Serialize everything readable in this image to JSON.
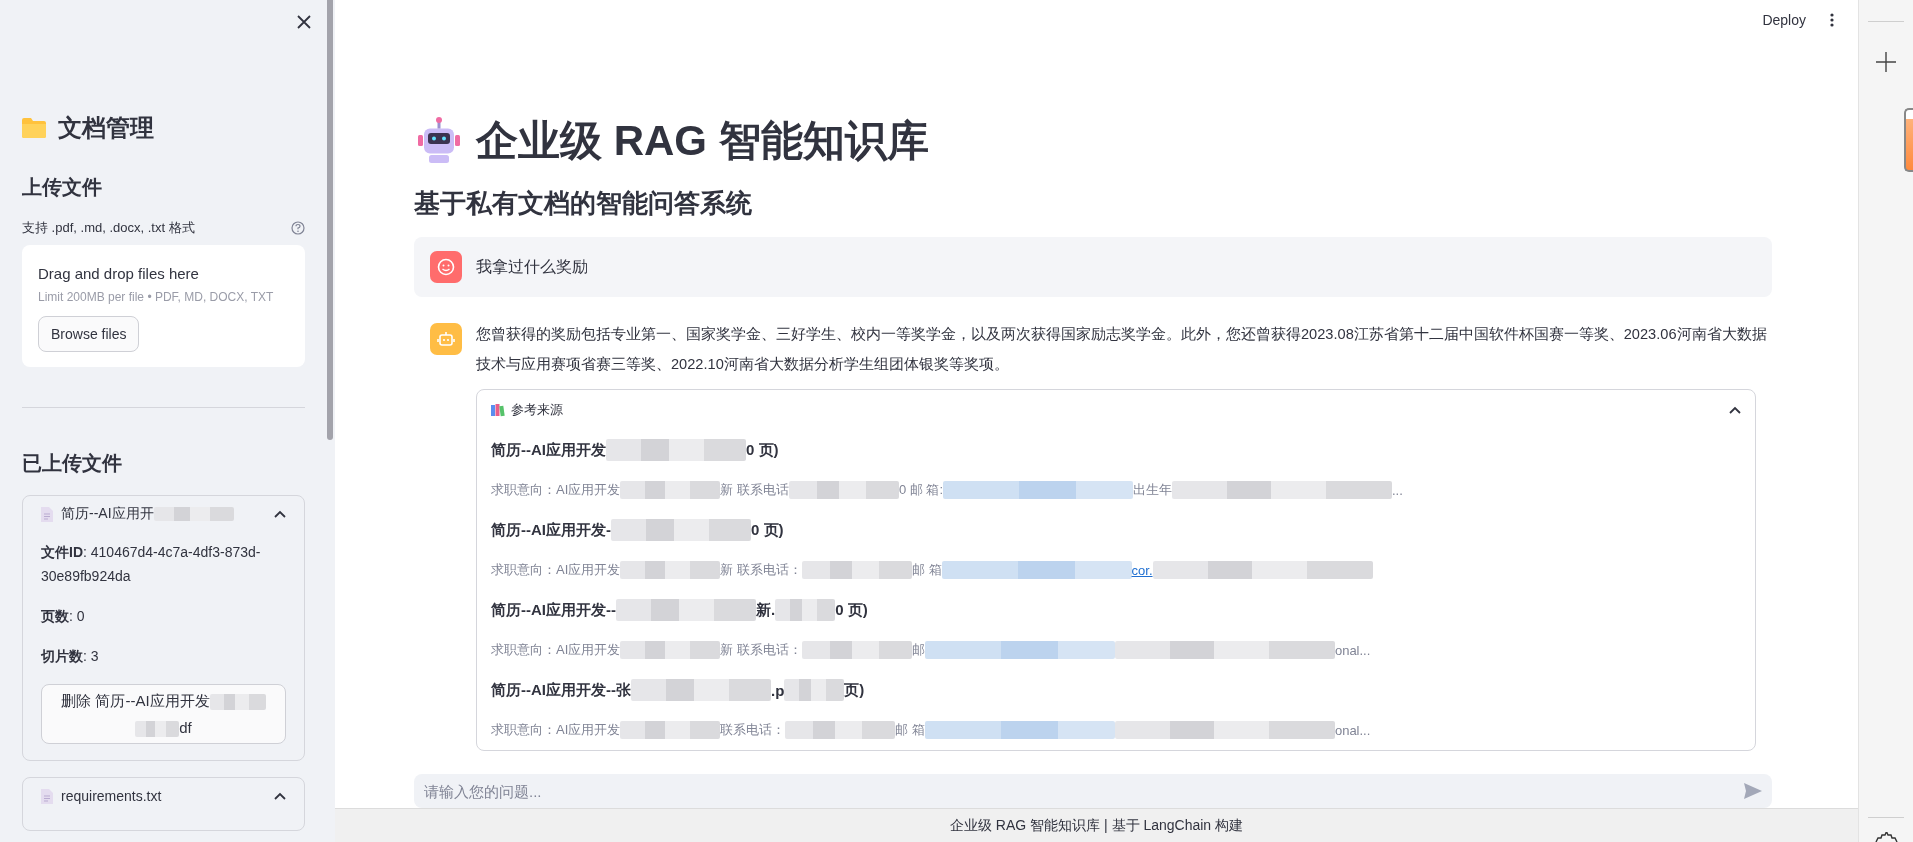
{
  "sidebar": {
    "title": "文档管理",
    "upload_heading": "上传文件",
    "upload_label": "支持 .pdf, .md, .docx, .txt 格式",
    "dropzone": {
      "title": "Drag and drop files here",
      "hint": "Limit 200MB per file • PDF, MD, DOCX, TXT",
      "button": "Browse files"
    },
    "uploaded_heading": "已上传文件",
    "files": [
      {
        "title": [
          {
            "kind": "text",
            "text": "简历--AI应用开"
          },
          {
            "kind": "blur"
          }
        ],
        "expanded": true,
        "details": [
          "**文件ID**: 410467d4-4c7a-4df3-873d-30e89fb924da",
          "**页数**: 0",
          "**切片数**: 3"
        ],
        "delete_button": [
          {
            "kind": "text",
            "text": "删除 简历--AI应用开发"
          },
          {
            "kind": "blur"
          },
          {
            "kind": "blur"
          },
          {
            "kind": "text",
            "text": "df"
          }
        ]
      },
      {
        "title": [
          {
            "kind": "text",
            "text": "requirements.txt"
          }
        ],
        "expanded": true
      }
    ]
  },
  "toolbar": {
    "deploy": "Deploy"
  },
  "main": {
    "title": "企业级 RAG 智能知识库",
    "subtitle": "基于私有文档的智能问答系统",
    "messages": [
      {
        "kind": "user",
        "text": "我拿过什么奖励"
      },
      {
        "kind": "assistant",
        "text": "您曾获得的奖励包括专业第一、国家奖学金、三好学生、校内一等奖学金，以及两次获得国家励志奖学金。此外，您还曾获得2023.08江苏省第十二届中国软件杯国赛一等奖、2023.06河南省大数据技术与应用赛项省赛三等奖、2022.10河南省大数据分析学生组团体银奖等奖项。",
        "sources": {
          "title": "参考来源",
          "expanded": true,
          "items": [
            {
              "title": [
                {
                  "kind": "text",
                  "text": "简历--AI应用开发"
                },
                {
                  "kind": "blur"
                },
                {
                  "kind": "text",
                  "text": "0 页)"
                }
              ],
              "snippet": [
                {
                  "kind": "text",
                  "text": "求职意向：AI应用开发"
                },
                {
                  "kind": "blur"
                },
                {
                  "kind": "text",
                  "text": "新 联系电话"
                },
                {
                  "kind": "blur"
                },
                {
                  "kind": "text",
                  "text": "0 邮 箱:"
                },
                {
                  "kind": "blur-link"
                },
                {
                  "kind": "text",
                  "text": "出生年"
                },
                {
                  "kind": "blur"
                },
                {
                  "kind": "text",
                  "text": "..."
                }
              ]
            },
            {
              "title": [
                {
                  "kind": "text",
                  "text": "简历--AI应用开发-"
                },
                {
                  "kind": "blur"
                },
                {
                  "kind": "text",
                  "text": "0 页)"
                }
              ],
              "snippet": [
                {
                  "kind": "text",
                  "text": "求职意向：AI应用开发"
                },
                {
                  "kind": "blur"
                },
                {
                  "kind": "text",
                  "text": "新 联系电话："
                },
                {
                  "kind": "blur"
                },
                {
                  "kind": "text",
                  "text": "邮 箱"
                },
                {
                  "kind": "blur-link"
                },
                {
                  "kind": "link",
                  "text": "cor."
                },
                {
                  "kind": "blur"
                }
              ]
            },
            {
              "title": [
                {
                  "kind": "text",
                  "text": "简历--AI应用开发--"
                },
                {
                  "kind": "blur"
                },
                {
                  "kind": "text",
                  "text": "新."
                },
                {
                  "kind": "blur"
                },
                {
                  "kind": "text",
                  "text": "0 页)"
                }
              ],
              "snippet": [
                {
                  "kind": "text",
                  "text": "求职意向：AI应用开发"
                },
                {
                  "kind": "blur"
                },
                {
                  "kind": "text",
                  "text": "新 联系电话："
                },
                {
                  "kind": "blur"
                },
                {
                  "kind": "text",
                  "text": "邮"
                },
                {
                  "kind": "blur-link"
                },
                {
                  "kind": "blur"
                },
                {
                  "kind": "text",
                  "text": "onal..."
                }
              ]
            },
            {
              "title": [
                {
                  "kind": "text",
                  "text": "简历--AI应用开发--张"
                },
                {
                  "kind": "blur"
                },
                {
                  "kind": "text",
                  "text": ".p"
                },
                {
                  "kind": "blur"
                },
                {
                  "kind": "text",
                  "text": "页)"
                }
              ],
              "snippet": [
                {
                  "kind": "text",
                  "text": "求职意向：AI应用开发"
                },
                {
                  "kind": "blur"
                },
                {
                  "kind": "text",
                  "text": "联系电话："
                },
                {
                  "kind": "blur"
                },
                {
                  "kind": "text",
                  "text": "邮 箱"
                },
                {
                  "kind": "blur-link"
                },
                {
                  "kind": "blur"
                },
                {
                  "kind": "text",
                  "text": "onal..."
                }
              ]
            }
          ]
        }
      }
    ]
  },
  "chat_input": {
    "placeholder": "请输入您的问题..."
  },
  "footer": "企业级 RAG 智能知识库 | 基于 LangChain 构建"
}
